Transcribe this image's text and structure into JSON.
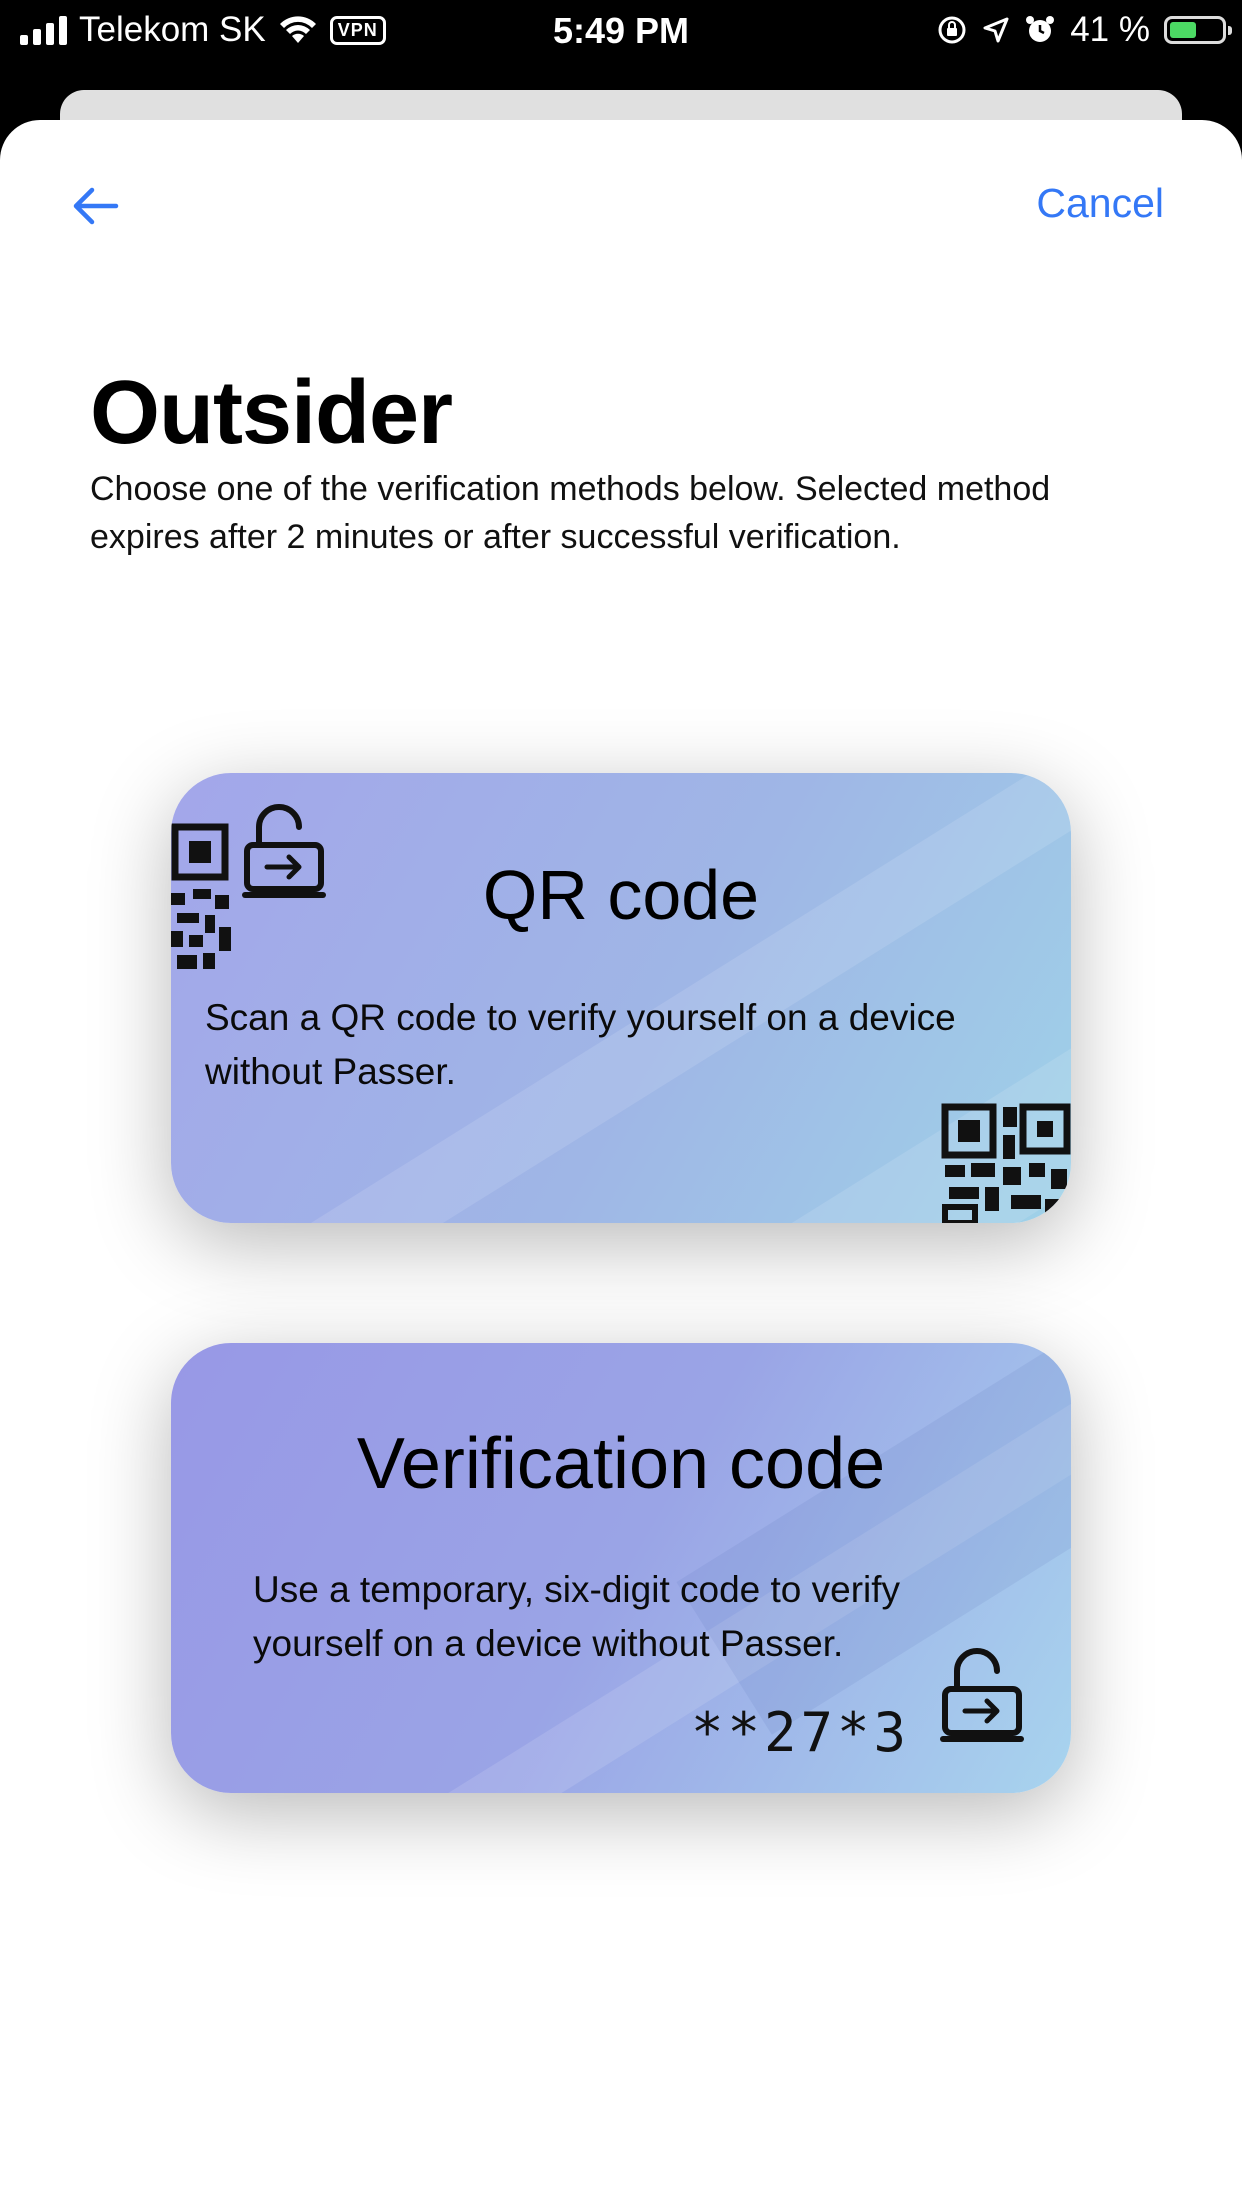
{
  "status_bar": {
    "carrier": "Telekom SK",
    "vpn": "VPN",
    "time": "5:49 PM",
    "battery_percent": "41 %",
    "battery_level": 0.41
  },
  "nav": {
    "back_icon": "arrow-left-icon",
    "cancel_label": "Cancel"
  },
  "page": {
    "title": "Outsider",
    "description": "Choose one of the verification methods below. Selected method expires after 2 minutes or after successful verification."
  },
  "cards": [
    {
      "title": "QR code",
      "text": "Scan a QR code to verify yourself on a device without Passer.",
      "icons": [
        "qr-code-icon",
        "unlock-login-icon"
      ]
    },
    {
      "title": "Verification code",
      "text": "Use a temporary, six-digit code to verify yourself on a device without Passer.",
      "code": "**27*3",
      "icons": [
        "unlock-login-icon"
      ]
    }
  ],
  "colors": {
    "accent": "#3478f6",
    "card_qr_start": "#a3a6ea",
    "card_qr_end": "#9fd2e8",
    "card_vc_start": "#9898e6",
    "card_vc_end": "#a8d4ee"
  }
}
